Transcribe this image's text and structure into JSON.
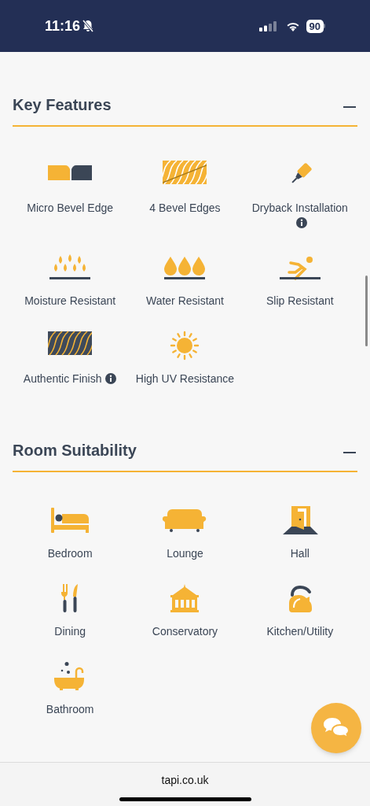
{
  "status_bar": {
    "time": "11:16",
    "battery": "90"
  },
  "sections": [
    {
      "title": "Key Features",
      "expanded": true,
      "items": [
        {
          "label": "Micro Bevel Edge",
          "kind": "micro-bevel",
          "info": false
        },
        {
          "label": "4 Bevel Edges",
          "kind": "wood-bevel",
          "info": false
        },
        {
          "label": "Dryback Installation",
          "kind": "glue",
          "info": true
        },
        {
          "label": "Moisture Resistant",
          "kind": "small-drops",
          "info": false
        },
        {
          "label": "Water Resistant",
          "kind": "big-drops",
          "info": false
        },
        {
          "label": "Slip Resistant",
          "kind": "slip",
          "info": false
        },
        {
          "label": "Authentic Finish",
          "kind": "wood-grain",
          "info": true
        },
        {
          "label": "High UV Resistance",
          "kind": "sun",
          "info": false
        }
      ]
    },
    {
      "title": "Room Suitability",
      "expanded": true,
      "items": [
        {
          "label": "Bedroom",
          "kind": "bed",
          "info": false
        },
        {
          "label": "Lounge",
          "kind": "sofa",
          "info": false
        },
        {
          "label": "Hall",
          "kind": "door",
          "info": false
        },
        {
          "label": "Dining",
          "kind": "cutlery",
          "info": false
        },
        {
          "label": "Conservatory",
          "kind": "gazebo",
          "info": false
        },
        {
          "label": "Kitchen/Utility",
          "kind": "kettle",
          "info": false
        },
        {
          "label": "Bathroom",
          "kind": "bath",
          "info": false
        }
      ]
    }
  ],
  "address_bar": {
    "url": "tapi.co.uk"
  }
}
